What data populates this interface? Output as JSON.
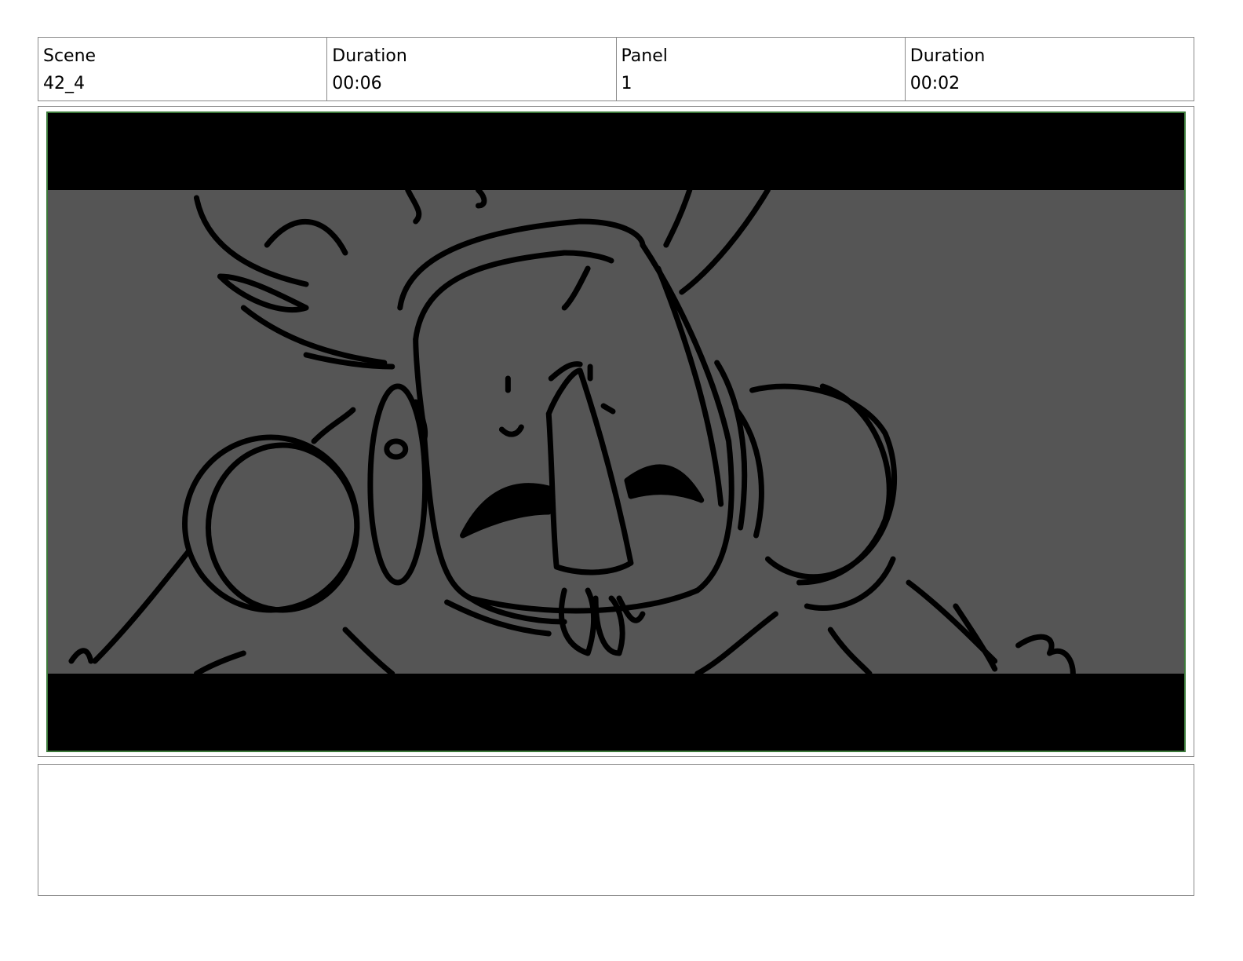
{
  "header": {
    "scene_label": "Scene",
    "scene_value": "42_4",
    "scene_duration_label": "Duration",
    "scene_duration_value": "00:06",
    "panel_label": "Panel",
    "panel_value": "1",
    "panel_duration_label": "Duration",
    "panel_duration_value": "00:02"
  },
  "panel": {
    "frame_border_color": "#3c7a3a",
    "background_color": "#555555"
  },
  "notes": {
    "text": ""
  }
}
